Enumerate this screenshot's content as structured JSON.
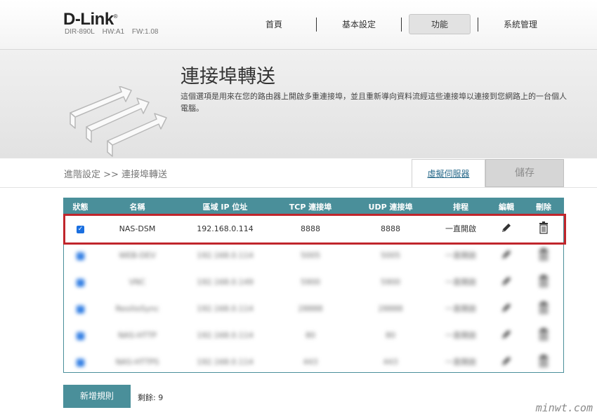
{
  "brand": {
    "logo": "D-Link",
    "model": "DIR-890L",
    "hw": "HW:A1",
    "fw": "FW:1.08"
  },
  "nav": {
    "items": [
      "首頁",
      "基本設定",
      "功能",
      "系統管理"
    ],
    "active": "功能"
  },
  "banner": {
    "title": "連接埠轉送",
    "description": "這個選項是用來在您的路由器上開啟多重連接埠，並且重新導向資料流經這些連接埠以連接到您網路上的一台個人電腦。"
  },
  "toolbar": {
    "breadcrumb": "進階設定 >> 連接埠轉送",
    "virtual_server_link": "虛擬伺服器",
    "save_label": "儲存"
  },
  "table": {
    "headers": [
      "狀態",
      "名稱",
      "區域 IP 位址",
      "TCP 連接埠",
      "UDP 連接埠",
      "排程",
      "編輯",
      "刪除"
    ],
    "rows": [
      {
        "name": "NAS-DSM",
        "ip": "192.168.0.114",
        "tcp": "8888",
        "udp": "8888",
        "schedule": "一直開啟"
      },
      {
        "name": "WEB-DEV",
        "ip": "192.168.0.114",
        "tcp": "5005",
        "udp": "5005",
        "schedule": "一直開啟"
      },
      {
        "name": "VNC",
        "ip": "192.168.0.149",
        "tcp": "5900",
        "udp": "5900",
        "schedule": "一直開啟"
      },
      {
        "name": "ResilioSync",
        "ip": "192.168.0.114",
        "tcp": "28888",
        "udp": "28888",
        "schedule": "一直開啟"
      },
      {
        "name": "NAS-HTTP",
        "ip": "192.168.0.114",
        "tcp": "80",
        "udp": "80",
        "schedule": "一直開啟"
      },
      {
        "name": "NAS-HTTPS",
        "ip": "192.168.0.114",
        "tcp": "443",
        "udp": "443",
        "schedule": "一直開啟"
      }
    ]
  },
  "footer": {
    "add_label": "新增規則",
    "remaining_label": "剩餘: 9"
  },
  "watermark": "minwt.com",
  "colors": {
    "accent": "#4a8f9a",
    "highlight": "#c0262c",
    "link": "#2b6c8c"
  },
  "icons": {
    "status": "checkbox-icon",
    "edit": "pencil-icon",
    "delete": "trash-icon"
  }
}
